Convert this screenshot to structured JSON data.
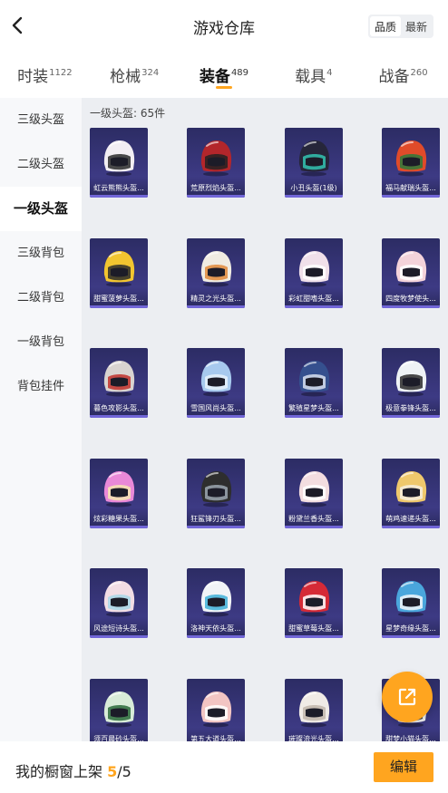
{
  "header": {
    "title": "游戏仓库",
    "sort_options": [
      "品质",
      "最新"
    ],
    "active_sort": 0
  },
  "tabs": [
    {
      "label": "时装",
      "count": "1122"
    },
    {
      "label": "枪械",
      "count": "324"
    },
    {
      "label": "装备",
      "count": "489"
    },
    {
      "label": "载具",
      "count": "4"
    },
    {
      "label": "战备",
      "count": "260"
    }
  ],
  "active_tab": 2,
  "sidebar": {
    "items": [
      "三级头盔",
      "二级头盔",
      "一级头盔",
      "三级背包",
      "二级背包",
      "一级背包",
      "背包挂件"
    ],
    "active": 2
  },
  "section": {
    "header": "一级头盔: 65件"
  },
  "items": [
    {
      "name": "虹云熊熊头盔...",
      "colors": [
        "#f2eef3",
        "#2a2a2a"
      ]
    },
    {
      "name": "荒原烈焰头盔...",
      "colors": [
        "#b3262b",
        "#222"
      ]
    },
    {
      "name": "小丑头盔(1级)",
      "colors": [
        "#26263a",
        "#33c4b0"
      ]
    },
    {
      "name": "福马献瑞头盔...",
      "colors": [
        "#e04b2a",
        "#2b7a3a"
      ]
    },
    {
      "name": "甜蜜菠萝头盔...",
      "colors": [
        "#f2c530",
        "#2b2b2b"
      ]
    },
    {
      "name": "精灵之光头盔...",
      "colors": [
        "#f0ece2",
        "#e08a3a"
      ]
    },
    {
      "name": "彩虹甜嗜头盔...",
      "colors": [
        "#f0e0ea",
        "#ffffff"
      ]
    },
    {
      "name": "四度牧梦使头...",
      "colors": [
        "#f4d3da",
        "#ffffff"
      ]
    },
    {
      "name": "暮色攻影头盔...",
      "colors": [
        "#d9d4d0",
        "#c0302a"
      ]
    },
    {
      "name": "雪国风尚头盔...",
      "colors": [
        "#a7c9ee",
        "#e8f2fb"
      ]
    },
    {
      "name": "繁殖星梦头盔...",
      "colors": [
        "#35508e",
        "#d8e0f0"
      ]
    },
    {
      "name": "极意拳锋头盔...",
      "colors": [
        "#eef2f5",
        "#2a2a2a"
      ]
    },
    {
      "name": "炫彩糖果头盔...",
      "colors": [
        "#e989d8",
        "#f6e7b0"
      ]
    },
    {
      "name": "狂鲨锋刃头盔...",
      "colors": [
        "#2e2e2e",
        "#9ba6b0"
      ]
    },
    {
      "name": "粉黛兰香头盔...",
      "colors": [
        "#f3dde0",
        "#ffffff"
      ]
    },
    {
      "name": "萌鸡速递头盔...",
      "colors": [
        "#efc86c",
        "#f6efe0"
      ]
    },
    {
      "name": "风途短诗头盔...",
      "colors": [
        "#f2dde4",
        "#a8d7e8"
      ]
    },
    {
      "name": "洛神天依头盔...",
      "colors": [
        "#f1f4f7",
        "#3fb0d8"
      ]
    },
    {
      "name": "甜蜜草莓头盔...",
      "colors": [
        "#d52a36",
        "#ffffff"
      ]
    },
    {
      "name": "星梦奇缘头盔...",
      "colors": [
        "#4aa6dc",
        "#f4f8fb"
      ]
    },
    {
      "name": "须百晨砂头盔...",
      "colors": [
        "#d8ecd8",
        "#2a6a3a"
      ]
    },
    {
      "name": "第五大道头盔...",
      "colors": [
        "#f2c5c3",
        "#ffffff"
      ]
    },
    {
      "name": "璀璨流光头盔...",
      "colors": [
        "#f0ebe6",
        "#c1b6aa"
      ]
    },
    {
      "name": "甜梦小猫头盔...",
      "colors": [
        "#f3f3f3",
        "#222222"
      ]
    }
  ],
  "bottom": {
    "shelf_label": "我的橱窗上架",
    "shelf_count": "5",
    "shelf_total": "/5",
    "edit_label": "编辑"
  },
  "accent_color": "#ffa51f"
}
